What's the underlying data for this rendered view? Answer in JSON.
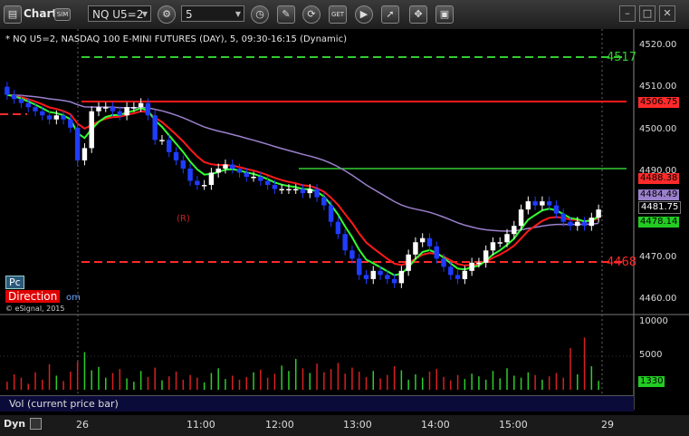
{
  "window": {
    "title": "Chart",
    "symbol": "NQ U5=2",
    "interval": "5",
    "chart_header": "* NQ U5=2, NASDAQ 100 E-MINI FUTURES (DAY), 5, 09:30-16:15 (Dynamic)"
  },
  "toolbar": {
    "icons": [
      "chart-icon",
      "settings-icon",
      "clock-icon",
      "pencil-icon",
      "refresh-icon",
      "get-icon",
      "play-icon",
      "tag-icon",
      "window-icon"
    ],
    "get_label": "GET"
  },
  "price_axis": {
    "ticks": [
      "4520.00",
      "4510.00",
      "4500.00",
      "4490.00",
      "4470.00",
      "4460.00"
    ]
  },
  "price_tags": [
    {
      "label": "4488.38",
      "color": "#ff2a2a",
      "text": "#000"
    },
    {
      "label": "4506.75",
      "color": "#ff2a2a",
      "text": "#000"
    },
    {
      "label": "4484.49",
      "color": "#9b80cc",
      "text": "#000"
    },
    {
      "label": "4481.75",
      "color": "#000000",
      "text": "#fff"
    },
    {
      "label": "4478.14",
      "color": "#22cc22",
      "text": "#000"
    }
  ],
  "levels": {
    "upper_label": "4517",
    "lower_label": "4468"
  },
  "volume": {
    "label": "Vol (current price bar)",
    "ticks": [
      "10000",
      "5000"
    ],
    "current": "1330"
  },
  "overlay": {
    "pc_label": "Pc",
    "direction_label": "Direction",
    "direction_suffix": "om",
    "copyright": "© eSignal, 2015",
    "r_marker": "(R)"
  },
  "time_axis": {
    "labels": [
      "26",
      "11:00",
      "12:00",
      "13:00",
      "14:00",
      "15:00",
      "29"
    ],
    "dyn_label": "Dyn"
  },
  "colors": {
    "up_candle": "#ffffff",
    "down_candle": "#1f3cff",
    "red_ma": "#ff1a1a",
    "green_ma": "#33ff33",
    "purple_ma": "#9b80cc",
    "level_green": "#33cc33",
    "level_red": "#ff2a2a"
  },
  "chart_data": {
    "type": "candlestick",
    "ylim": [
      4457,
      4523
    ],
    "opens": [
      4512,
      4510,
      4509,
      4508,
      4507,
      4506,
      4505,
      4504,
      4505,
      4504,
      4502,
      4494,
      4497,
      4506,
      4507,
      4507,
      4506,
      4505,
      4507,
      4507,
      4508,
      4505,
      4499,
      4499,
      4496,
      4494,
      4492,
      4489,
      4488,
      4488,
      4491,
      4492,
      4493,
      4492,
      4491,
      4490,
      4490,
      4489,
      4488,
      4487,
      4487,
      4487,
      4487,
      4486,
      4487,
      4485,
      4483,
      4479,
      4476,
      4472,
      4470,
      4466,
      4465,
      4467,
      4466,
      4465,
      4464,
      4467,
      4471,
      4474,
      4475,
      4473,
      4470,
      4468,
      4466,
      4465,
      4467,
      4469,
      4469,
      4472,
      4474,
      4474,
      4476,
      4478,
      4482,
      4484,
      4483,
      4484,
      4483,
      4481,
      4479,
      4478,
      4479,
      4478,
      4480
    ],
    "closes": [
      4510,
      4509,
      4508,
      4507,
      4506,
      4505,
      4504,
      4505,
      4504,
      4502,
      4494,
      4497,
      4506,
      4507,
      4507,
      4506,
      4505,
      4507,
      4507,
      4508,
      4505,
      4499,
      4499,
      4496,
      4494,
      4492,
      4489,
      4488,
      4488,
      4491,
      4492,
      4493,
      4492,
      4491,
      4490,
      4490,
      4489,
      4488,
      4487,
      4487,
      4487,
      4487,
      4486,
      4487,
      4485,
      4483,
      4479,
      4476,
      4472,
      4470,
      4466,
      4465,
      4467,
      4466,
      4465,
      4464,
      4467,
      4471,
      4474,
      4475,
      4473,
      4470,
      4468,
      4466,
      4465,
      4467,
      4469,
      4469,
      4472,
      4474,
      4474,
      4476,
      4478,
      4482,
      4484,
      4483,
      4484,
      4483,
      4481,
      4479,
      4478,
      4479,
      4478,
      4480,
      4482
    ],
    "volumes": [
      1200,
      2300,
      1800,
      900,
      2600,
      1500,
      3800,
      2100,
      1300,
      2700,
      4200,
      5600,
      2900,
      3400,
      1800,
      2500,
      3100,
      1700,
      1200,
      2800,
      1900,
      3300,
      1400,
      2000,
      2700,
      1500,
      2200,
      1800,
      1100,
      2500,
      3200,
      1600,
      2100,
      1500,
      1900,
      2600,
      3000,
      1800,
      2400,
      3600,
      2800,
      4600,
      3200,
      2500,
      3900,
      2600,
      3100,
      4000,
      2400,
      3300,
      2700,
      1900,
      2800,
      1700,
      2200,
      3500,
      2900,
      1500,
      2300,
      1800,
      2700,
      3100,
      1900,
      1400,
      2200,
      1600,
      2400,
      2000,
      1500,
      2800,
      1700,
      3200,
      2100,
      1800,
      2600,
      2200,
      1500,
      2000,
      2500,
      1800,
      6200,
      2300,
      7800,
      3500,
      1330
    ]
  }
}
